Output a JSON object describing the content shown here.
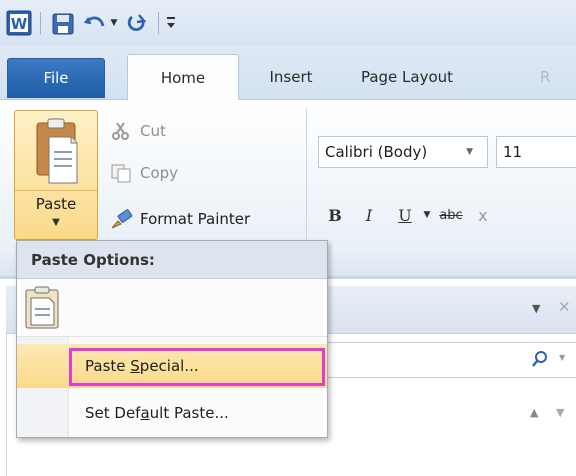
{
  "quick_access": {
    "items": [
      "word-app-icon",
      "save-icon",
      "undo-icon",
      "dropdown-arrow-icon",
      "redo-icon",
      "customize-qat-icon"
    ]
  },
  "tabs": [
    {
      "label": "File"
    },
    {
      "label": "Home"
    },
    {
      "label": "Insert"
    },
    {
      "label": "Page Layout"
    },
    {
      "label": "R"
    }
  ],
  "clipboard": {
    "paste_label": "Paste",
    "cut_label": "Cut",
    "copy_label": "Copy",
    "format_painter_label": "Format Painter"
  },
  "font": {
    "font_name": "Calibri (Body)",
    "font_size": "11",
    "format_buttons": [
      "B",
      "I",
      "U",
      "abc",
      "x"
    ]
  },
  "paste_menu": {
    "header": "Paste Options:",
    "items": [
      {
        "prefix": "Paste ",
        "mnemonic": "S",
        "suffix": "pecial...",
        "highlighted": true
      },
      {
        "prefix": "Set Def",
        "mnemonic": "a",
        "suffix": "ult Paste...",
        "highlighted": false
      }
    ]
  },
  "colors": {
    "file_tab": "#2a64ad",
    "paste_highlight": "#fbd98a",
    "callout_box": "#e23bd6"
  }
}
